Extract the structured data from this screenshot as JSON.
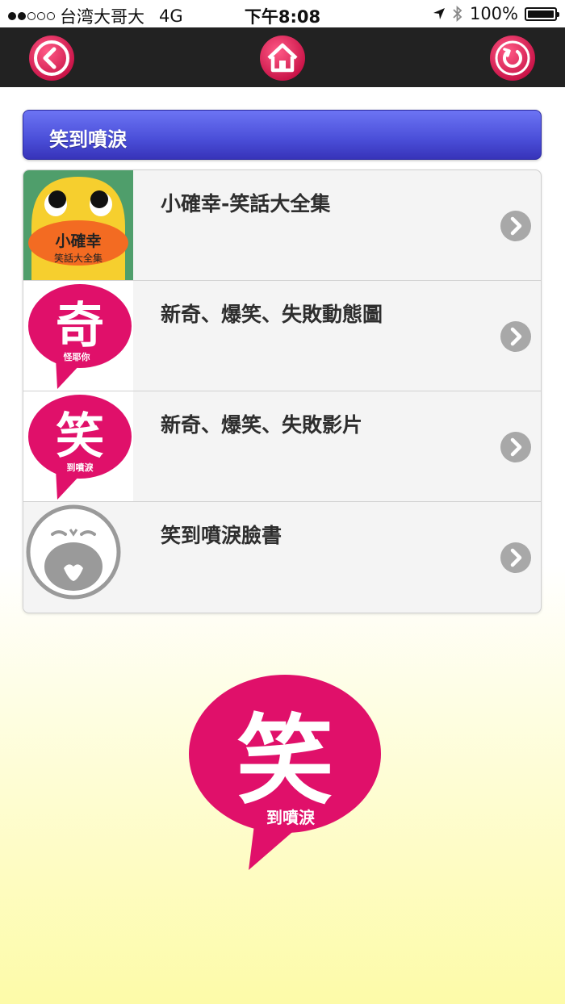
{
  "status_bar": {
    "carrier": "台湾大哥大",
    "network": "4G",
    "time": "下午8:08",
    "battery": "100%",
    "battery_level": 1.0,
    "signal_bars_filled": 2,
    "signal_bars_total": 5
  },
  "toolbar": {
    "back_icon": "back-arrow-icon",
    "home_icon": "home-icon",
    "refresh_icon": "refresh-icon",
    "accent": "#e0174f"
  },
  "header": {
    "title": "笑到噴淚",
    "color": "#5056dc"
  },
  "list": {
    "items": [
      {
        "title": "小確幸-笑話大全集",
        "thumb_text_1": "小確幸",
        "thumb_text_2": "笑話大全集",
        "icon": "duck-logo"
      },
      {
        "title": "新奇、爆笑、失敗動態圖",
        "thumb_text_1": "奇",
        "thumb_text_2": "怪耶你",
        "icon": "qi-speech-bubble-logo"
      },
      {
        "title": "新奇、爆笑、失敗影片",
        "thumb_text_1": "笑",
        "thumb_text_2": "到噴淚",
        "icon": "xiao-speech-bubble-logo"
      },
      {
        "title": "笑到噴淚臉書",
        "icon": "crying-face-logo"
      }
    ]
  },
  "logo": {
    "main_char": "笑",
    "sub_text": "到噴淚",
    "color": "#e0106a"
  }
}
